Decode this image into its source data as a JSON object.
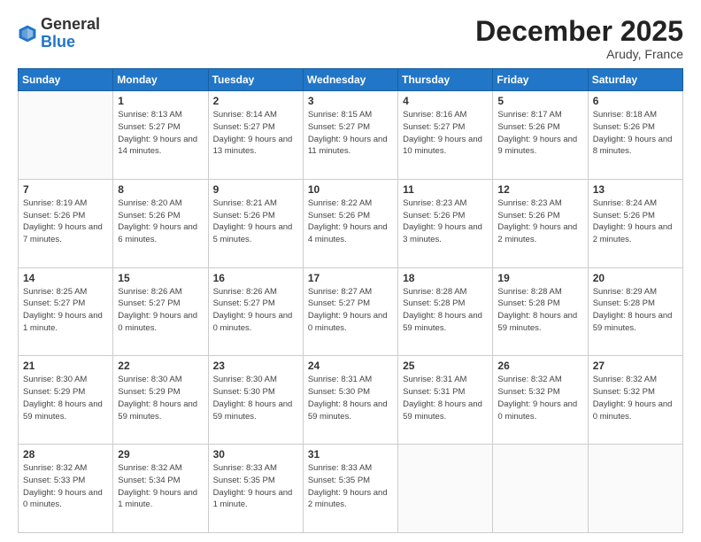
{
  "header": {
    "logo_general": "General",
    "logo_blue": "Blue",
    "title": "December 2025",
    "location": "Arudy, France"
  },
  "weekdays": [
    "Sunday",
    "Monday",
    "Tuesday",
    "Wednesday",
    "Thursday",
    "Friday",
    "Saturday"
  ],
  "weeks": [
    [
      {
        "num": "",
        "info": ""
      },
      {
        "num": "1",
        "info": "Sunrise: 8:13 AM\nSunset: 5:27 PM\nDaylight: 9 hours\nand 14 minutes."
      },
      {
        "num": "2",
        "info": "Sunrise: 8:14 AM\nSunset: 5:27 PM\nDaylight: 9 hours\nand 13 minutes."
      },
      {
        "num": "3",
        "info": "Sunrise: 8:15 AM\nSunset: 5:27 PM\nDaylight: 9 hours\nand 11 minutes."
      },
      {
        "num": "4",
        "info": "Sunrise: 8:16 AM\nSunset: 5:27 PM\nDaylight: 9 hours\nand 10 minutes."
      },
      {
        "num": "5",
        "info": "Sunrise: 8:17 AM\nSunset: 5:26 PM\nDaylight: 9 hours\nand 9 minutes."
      },
      {
        "num": "6",
        "info": "Sunrise: 8:18 AM\nSunset: 5:26 PM\nDaylight: 9 hours\nand 8 minutes."
      }
    ],
    [
      {
        "num": "7",
        "info": "Sunrise: 8:19 AM\nSunset: 5:26 PM\nDaylight: 9 hours\nand 7 minutes."
      },
      {
        "num": "8",
        "info": "Sunrise: 8:20 AM\nSunset: 5:26 PM\nDaylight: 9 hours\nand 6 minutes."
      },
      {
        "num": "9",
        "info": "Sunrise: 8:21 AM\nSunset: 5:26 PM\nDaylight: 9 hours\nand 5 minutes."
      },
      {
        "num": "10",
        "info": "Sunrise: 8:22 AM\nSunset: 5:26 PM\nDaylight: 9 hours\nand 4 minutes."
      },
      {
        "num": "11",
        "info": "Sunrise: 8:23 AM\nSunset: 5:26 PM\nDaylight: 9 hours\nand 3 minutes."
      },
      {
        "num": "12",
        "info": "Sunrise: 8:23 AM\nSunset: 5:26 PM\nDaylight: 9 hours\nand 2 minutes."
      },
      {
        "num": "13",
        "info": "Sunrise: 8:24 AM\nSunset: 5:26 PM\nDaylight: 9 hours\nand 2 minutes."
      }
    ],
    [
      {
        "num": "14",
        "info": "Sunrise: 8:25 AM\nSunset: 5:27 PM\nDaylight: 9 hours\nand 1 minute."
      },
      {
        "num": "15",
        "info": "Sunrise: 8:26 AM\nSunset: 5:27 PM\nDaylight: 9 hours\nand 0 minutes."
      },
      {
        "num": "16",
        "info": "Sunrise: 8:26 AM\nSunset: 5:27 PM\nDaylight: 9 hours\nand 0 minutes."
      },
      {
        "num": "17",
        "info": "Sunrise: 8:27 AM\nSunset: 5:27 PM\nDaylight: 9 hours\nand 0 minutes."
      },
      {
        "num": "18",
        "info": "Sunrise: 8:28 AM\nSunset: 5:28 PM\nDaylight: 8 hours\nand 59 minutes."
      },
      {
        "num": "19",
        "info": "Sunrise: 8:28 AM\nSunset: 5:28 PM\nDaylight: 8 hours\nand 59 minutes."
      },
      {
        "num": "20",
        "info": "Sunrise: 8:29 AM\nSunset: 5:28 PM\nDaylight: 8 hours\nand 59 minutes."
      }
    ],
    [
      {
        "num": "21",
        "info": "Sunrise: 8:30 AM\nSunset: 5:29 PM\nDaylight: 8 hours\nand 59 minutes."
      },
      {
        "num": "22",
        "info": "Sunrise: 8:30 AM\nSunset: 5:29 PM\nDaylight: 8 hours\nand 59 minutes."
      },
      {
        "num": "23",
        "info": "Sunrise: 8:30 AM\nSunset: 5:30 PM\nDaylight: 8 hours\nand 59 minutes."
      },
      {
        "num": "24",
        "info": "Sunrise: 8:31 AM\nSunset: 5:30 PM\nDaylight: 8 hours\nand 59 minutes."
      },
      {
        "num": "25",
        "info": "Sunrise: 8:31 AM\nSunset: 5:31 PM\nDaylight: 8 hours\nand 59 minutes."
      },
      {
        "num": "26",
        "info": "Sunrise: 8:32 AM\nSunset: 5:32 PM\nDaylight: 9 hours\nand 0 minutes."
      },
      {
        "num": "27",
        "info": "Sunrise: 8:32 AM\nSunset: 5:32 PM\nDaylight: 9 hours\nand 0 minutes."
      }
    ],
    [
      {
        "num": "28",
        "info": "Sunrise: 8:32 AM\nSunset: 5:33 PM\nDaylight: 9 hours\nand 0 minutes."
      },
      {
        "num": "29",
        "info": "Sunrise: 8:32 AM\nSunset: 5:34 PM\nDaylight: 9 hours\nand 1 minute."
      },
      {
        "num": "30",
        "info": "Sunrise: 8:33 AM\nSunset: 5:35 PM\nDaylight: 9 hours\nand 1 minute."
      },
      {
        "num": "31",
        "info": "Sunrise: 8:33 AM\nSunset: 5:35 PM\nDaylight: 9 hours\nand 2 minutes."
      },
      {
        "num": "",
        "info": ""
      },
      {
        "num": "",
        "info": ""
      },
      {
        "num": "",
        "info": ""
      }
    ]
  ]
}
